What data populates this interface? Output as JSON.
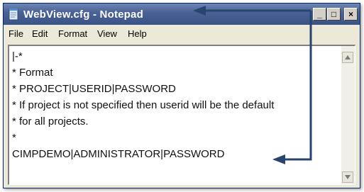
{
  "window": {
    "title": "WebView.cfg - Notepad",
    "controls": {
      "minimize": "_",
      "maximize": "□",
      "close": "×"
    }
  },
  "menu": [
    "File",
    "Edit",
    "Format",
    "View",
    "Help"
  ],
  "editor": {
    "lines": [
      "|-*",
      "* Format",
      "* PROJECT|USERID|PASSWORD",
      "* If project is not specified then userid will be the default",
      "* for all projects.",
      "*",
      "CIMPDEMO|ADMINISTRATOR|PASSWORD"
    ]
  },
  "annotation": {
    "arrow_color": "#2a4470"
  }
}
